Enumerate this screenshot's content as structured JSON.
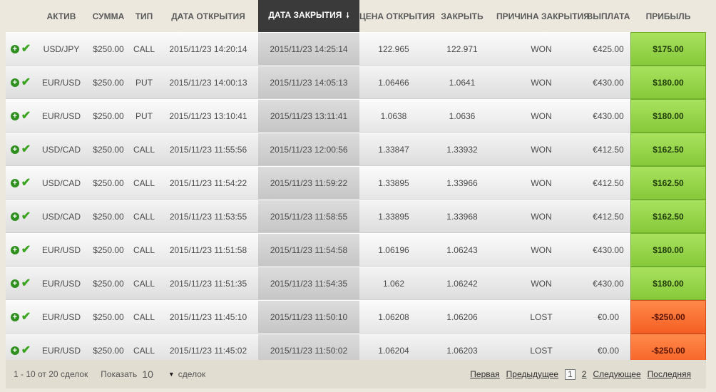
{
  "columns": {
    "asset": "АКТИВ",
    "amount": "СУММА",
    "type": "ТИП",
    "open_date": "ДАТА ОТКРЫТИЯ",
    "close_date": "ДАТА ЗАКРЫТИЯ",
    "open_price": "ЦЕНА ОТКРЫТИЯ",
    "close_price": "ЗАКРЫТЬ",
    "reason": "ПРИЧИНА ЗАКРЫТИЯ",
    "payout": "ВЫПЛАТА",
    "profit": "ПРИБЫЛЬ"
  },
  "sort_arrow_icon": "arrow-down-icon",
  "icons": {
    "expand": "plus-circle-icon",
    "status": "checkmark-icon"
  },
  "colors": {
    "profit_won": "#8fd13f",
    "profit_lost": "#f8692c",
    "sorted_header": "#3a3a3a"
  },
  "rows": [
    {
      "asset": "USD/JPY",
      "amount": "$250.00",
      "type": "CALL",
      "open_date": "2015/11/23 14:20:14",
      "close_date": "2015/11/23 14:25:14",
      "open_price": "122.965",
      "close_price": "122.971",
      "reason": "WON",
      "payout": "€425.00",
      "profit": "$175.00",
      "result": "won"
    },
    {
      "asset": "EUR/USD",
      "amount": "$250.00",
      "type": "PUT",
      "open_date": "2015/11/23 14:00:13",
      "close_date": "2015/11/23 14:05:13",
      "open_price": "1.06466",
      "close_price": "1.0641",
      "reason": "WON",
      "payout": "€430.00",
      "profit": "$180.00",
      "result": "won"
    },
    {
      "asset": "EUR/USD",
      "amount": "$250.00",
      "type": "PUT",
      "open_date": "2015/11/23 13:10:41",
      "close_date": "2015/11/23 13:11:41",
      "open_price": "1.0638",
      "close_price": "1.0636",
      "reason": "WON",
      "payout": "€430.00",
      "profit": "$180.00",
      "result": "won"
    },
    {
      "asset": "USD/CAD",
      "amount": "$250.00",
      "type": "CALL",
      "open_date": "2015/11/23 11:55:56",
      "close_date": "2015/11/23 12:00:56",
      "open_price": "1.33847",
      "close_price": "1.33932",
      "reason": "WON",
      "payout": "€412.50",
      "profit": "$162.50",
      "result": "won"
    },
    {
      "asset": "USD/CAD",
      "amount": "$250.00",
      "type": "CALL",
      "open_date": "2015/11/23 11:54:22",
      "close_date": "2015/11/23 11:59:22",
      "open_price": "1.33895",
      "close_price": "1.33966",
      "reason": "WON",
      "payout": "€412.50",
      "profit": "$162.50",
      "result": "won"
    },
    {
      "asset": "USD/CAD",
      "amount": "$250.00",
      "type": "CALL",
      "open_date": "2015/11/23 11:53:55",
      "close_date": "2015/11/23 11:58:55",
      "open_price": "1.33895",
      "close_price": "1.33968",
      "reason": "WON",
      "payout": "€412.50",
      "profit": "$162.50",
      "result": "won"
    },
    {
      "asset": "EUR/USD",
      "amount": "$250.00",
      "type": "CALL",
      "open_date": "2015/11/23 11:51:58",
      "close_date": "2015/11/23 11:54:58",
      "open_price": "1.06196",
      "close_price": "1.06243",
      "reason": "WON",
      "payout": "€430.00",
      "profit": "$180.00",
      "result": "won"
    },
    {
      "asset": "EUR/USD",
      "amount": "$250.00",
      "type": "CALL",
      "open_date": "2015/11/23 11:51:35",
      "close_date": "2015/11/23 11:54:35",
      "open_price": "1.062",
      "close_price": "1.06242",
      "reason": "WON",
      "payout": "€430.00",
      "profit": "$180.00",
      "result": "won"
    },
    {
      "asset": "EUR/USD",
      "amount": "$250.00",
      "type": "CALL",
      "open_date": "2015/11/23 11:45:10",
      "close_date": "2015/11/23 11:50:10",
      "open_price": "1.06208",
      "close_price": "1.06206",
      "reason": "LOST",
      "payout": "€0.00",
      "profit": "-$250.00",
      "result": "lost"
    },
    {
      "asset": "EUR/USD",
      "amount": "$250.00",
      "type": "CALL",
      "open_date": "2015/11/23 11:45:02",
      "close_date": "2015/11/23 11:50:02",
      "open_price": "1.06204",
      "close_price": "1.06203",
      "reason": "LOST",
      "payout": "€0.00",
      "profit": "-$250.00",
      "result": "lost"
    }
  ],
  "footer": {
    "info": "1 - 10 от 20 сделок",
    "show_label": "Показать",
    "show_value": "10",
    "show_suffix": "сделок",
    "first": "Первая",
    "prev": "Предыдущее",
    "pages": [
      "1",
      "2"
    ],
    "current_page": "1",
    "next": "Следующее",
    "last": "Последняя"
  }
}
